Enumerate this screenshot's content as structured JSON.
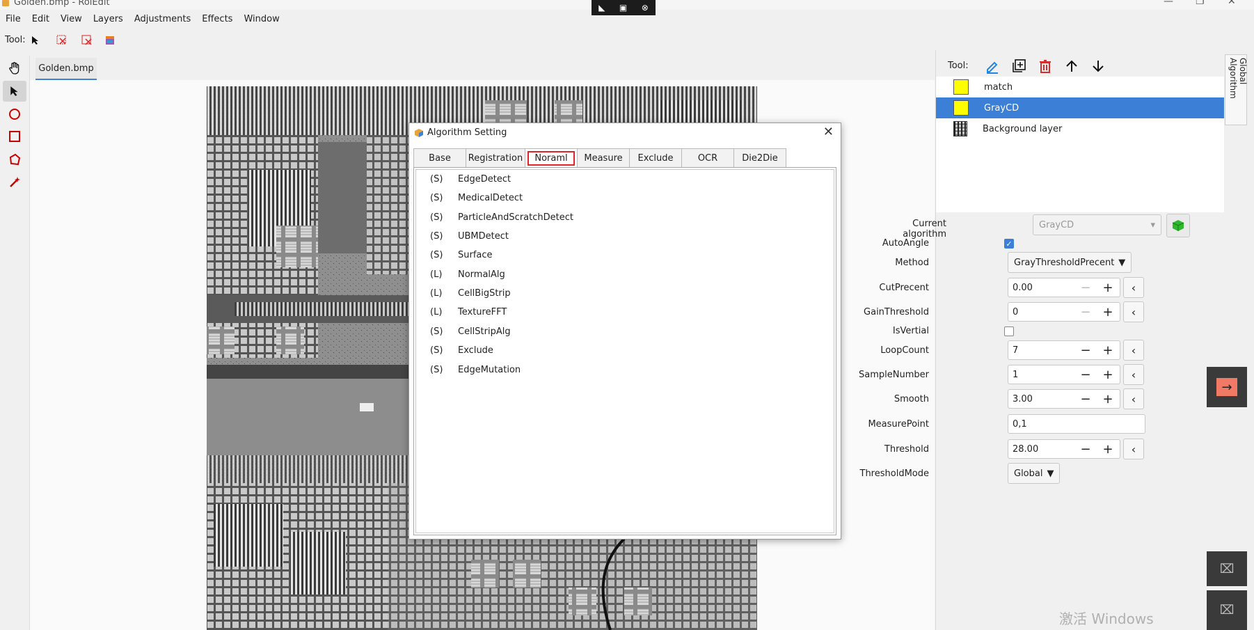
{
  "window": {
    "title": "Golden.bmp - RoiEdit"
  },
  "menu": [
    "File",
    "Edit",
    "View",
    "Layers",
    "Adjustments",
    "Effects",
    "Window"
  ],
  "toolbar": {
    "label": "Tool:"
  },
  "document": {
    "tab": "Golden.bmp"
  },
  "dialog": {
    "title": "Algorithm Setting",
    "tabs": [
      "Base",
      "Registration",
      "Noraml",
      "Measure",
      "Exclude",
      "OCR",
      "Die2Die"
    ],
    "selected_tab": "Noraml",
    "algorithms": [
      {
        "kind": "(S)",
        "name": "EdgeDetect"
      },
      {
        "kind": "(S)",
        "name": "MedicalDetect"
      },
      {
        "kind": "(S)",
        "name": "ParticleAndScratchDetect"
      },
      {
        "kind": "(S)",
        "name": "UBMDetect"
      },
      {
        "kind": "(S)",
        "name": "Surface"
      },
      {
        "kind": "(L)",
        "name": "NormalAlg"
      },
      {
        "kind": "(L)",
        "name": "CellBigStrip"
      },
      {
        "kind": "(L)",
        "name": "TextureFFT"
      },
      {
        "kind": "(S)",
        "name": "CellStripAlg"
      },
      {
        "kind": "(S)",
        "name": "Exclude"
      },
      {
        "kind": "(S)",
        "name": "EdgeMutation"
      }
    ]
  },
  "layers_panel": {
    "label": "Tool:",
    "layers": [
      {
        "name": "match",
        "selected": false
      },
      {
        "name": "GrayCD",
        "selected": true
      },
      {
        "name": "Background layer",
        "selected": false
      }
    ],
    "side_tab": "Global Algorithm"
  },
  "properties": {
    "current_algorithm_label": "Current algorithm",
    "current_algorithm_value": "GrayCD",
    "auto_angle_label": "AutoAngle",
    "auto_angle": true,
    "method_label": "Method",
    "method_value": "GrayThresholdPrecent",
    "cut_precent_label": "CutPrecent",
    "cut_precent": "0.00",
    "gain_threshold_label": "GainThreshold",
    "gain_threshold": "0",
    "is_vertial_label": "IsVertial",
    "is_vertial": false,
    "loop_count_label": "LoopCount",
    "loop_count": "7",
    "sample_number_label": "SampleNumber",
    "sample_number": "1",
    "smooth_label": "Smooth",
    "smooth": "3.00",
    "measure_point_label": "MeasurePoint",
    "measure_point": "0,1",
    "threshold_label": "Threshold",
    "threshold": "28.00",
    "threshold_mode_label": "ThresholdMode",
    "threshold_mode": "Global"
  },
  "watermark": "激活 Windows",
  "colors": {
    "accent": "#3c7fd6",
    "highlight": "#e0242b",
    "swatch": "#ffff00"
  }
}
